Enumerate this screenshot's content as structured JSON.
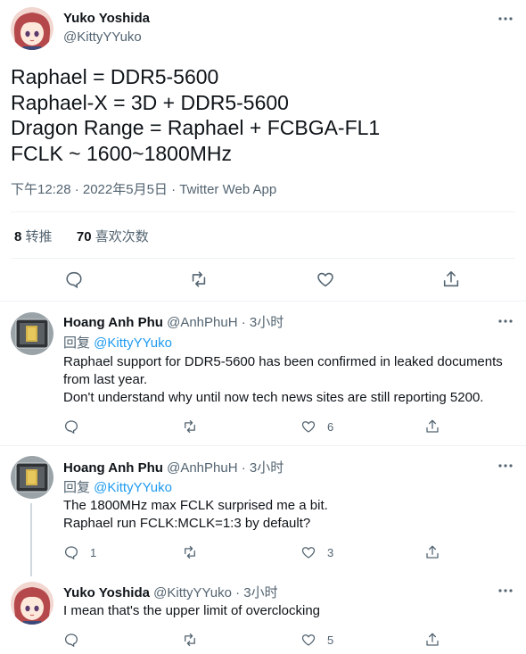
{
  "main": {
    "name": "Yuko Yoshida",
    "handle": "@KittyYYuko",
    "lines": [
      "Raphael = DDR5-5600",
      "Raphael-X = 3D + DDR5-5600",
      "Dragon Range = Raphael + FCBGA-FL1",
      "FCLK ~ 1600~1800MHz"
    ],
    "meta": "下午12:28 · 2022年5月5日 · Twitter Web App",
    "retweets_count": "8",
    "retweets_label": "转推",
    "likes_count": "70",
    "likes_label": "喜欢次数"
  },
  "replies": [
    {
      "name": "Hoang Anh Phu",
      "handle": "@AnhPhuH",
      "time": " · 3小时",
      "replying_prefix": "回复 ",
      "replying_to": "@KittyYYuko",
      "lines": [
        "Raphael support for DDR5-5600 has been confirmed in leaked documents",
        "from last year.",
        "Don't understand why until now tech news sites are still reporting 5200."
      ],
      "reply_count": "",
      "like_count": "6"
    },
    {
      "name": "Hoang Anh Phu",
      "handle": "@AnhPhuH",
      "time": " · 3小时",
      "replying_prefix": "回复 ",
      "replying_to": "@KittyYYuko",
      "lines": [
        "The 1800MHz max FCLK surprised me a bit.",
        "Raphael run FCLK:MCLK=1:3 by default?"
      ],
      "reply_count": "1",
      "like_count": "3"
    },
    {
      "name": "Yuko Yoshida",
      "handle": "@KittyYYuko",
      "time": " · 3小时",
      "lines": [
        "I mean that's the upper limit of overclocking"
      ],
      "reply_count": "",
      "like_count": "5"
    }
  ],
  "colors": {
    "accent": "#1d9bf0",
    "secondary_text": "#536471",
    "icon": "#536471",
    "divider": "#eff3f4"
  }
}
